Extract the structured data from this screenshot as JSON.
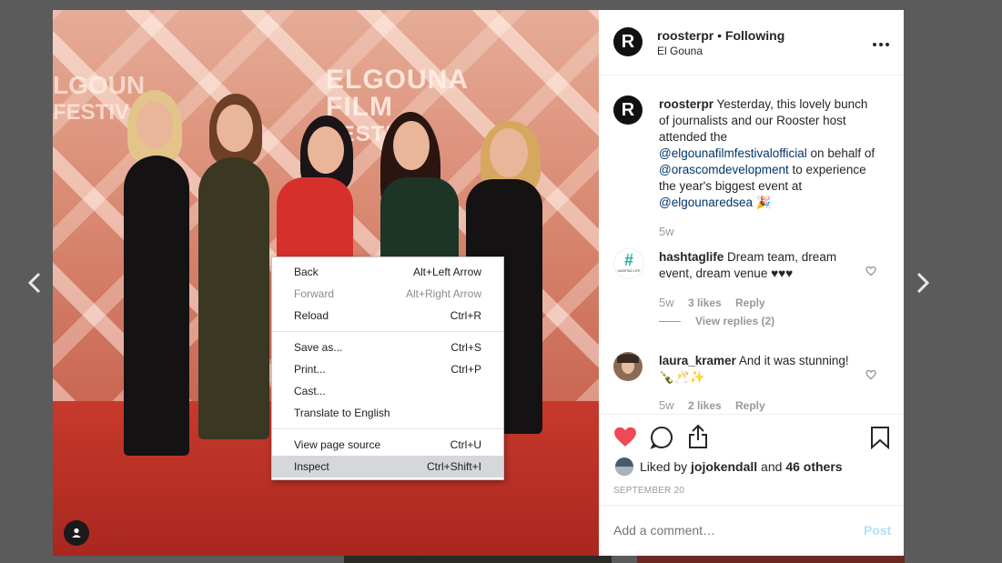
{
  "post": {
    "username": "roosterpr",
    "separator": " • ",
    "follow_state": "Following",
    "location": "El Gouna",
    "logo_letter": "R",
    "caption": {
      "username": "roosterpr",
      "text_1": "Yesterday, this lovely bunch of journalists and our Rooster host attended the ",
      "mention_1": "@elgounafilmfestivalofficial",
      "text_2": " on behalf of ",
      "mention_2": "@orascomdevelopment",
      "text_3": " to experience the year's biggest event at ",
      "mention_3": "@elgounaredsea",
      "emoji": "🎉",
      "age": "5w"
    },
    "photo_sign": {
      "line1": "ELGOUNA",
      "line2": "FILM",
      "line3": "FESTIVAL",
      "left1": "LGOUN",
      "left2": "FESTIVAL"
    }
  },
  "comments": [
    {
      "username": "hashtaglife",
      "text": "Dream team, dream event, dream venue ♥♥♥",
      "age": "5w",
      "likes": "3 likes",
      "reply": "Reply",
      "view_replies": "View replies (2)",
      "avatar_glyph": "#",
      "avatar_caption": "HASHTAG LIFE"
    },
    {
      "username": "laura_kramer",
      "text": "And it was stunning! 🍾🥂✨",
      "age": "5w",
      "likes": "2 likes",
      "reply": "Reply"
    }
  ],
  "likes": {
    "prefix": "Liked by ",
    "user": "jojokendall",
    "and": " and ",
    "others": "46 others"
  },
  "date": "SEPTEMBER 20",
  "comment_box": {
    "placeholder": "Add a comment…",
    "post_label": "Post"
  },
  "context_menu": {
    "items": [
      {
        "label": "Back",
        "shortcut": "Alt+Left Arrow"
      },
      {
        "label": "Forward",
        "shortcut": "Alt+Right Arrow"
      },
      {
        "label": "Reload",
        "shortcut": "Ctrl+R"
      },
      {
        "label": "Save as...",
        "shortcut": "Ctrl+S"
      },
      {
        "label": "Print...",
        "shortcut": "Ctrl+P"
      },
      {
        "label": "Cast...",
        "shortcut": ""
      },
      {
        "label": "Translate to English",
        "shortcut": ""
      },
      {
        "label": "View page source",
        "shortcut": "Ctrl+U"
      },
      {
        "label": "Inspect",
        "shortcut": "Ctrl+Shift+I"
      }
    ]
  },
  "icons": {
    "prev": "chevron-left-icon",
    "next": "chevron-right-icon",
    "more": "more-options-icon",
    "like": "heart-icon",
    "comment": "comment-icon",
    "share": "share-icon",
    "save": "bookmark-icon",
    "tagged": "user-icon"
  },
  "colors": {
    "like_heart": "#ed4956",
    "link": "#003569",
    "post_button": "#b2dffc"
  }
}
